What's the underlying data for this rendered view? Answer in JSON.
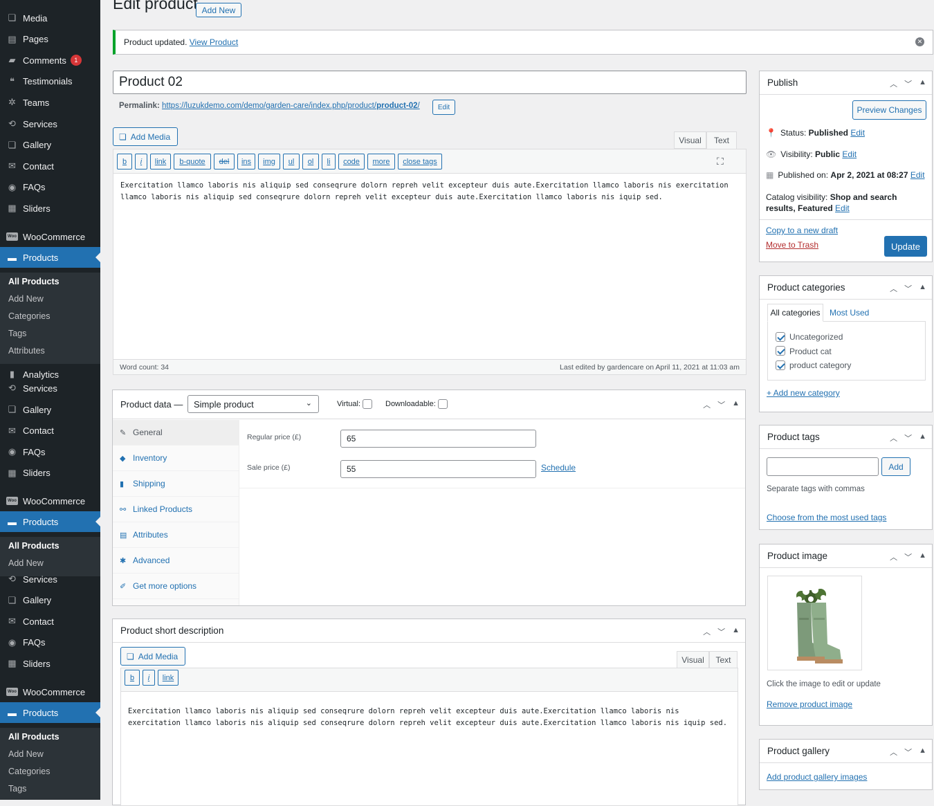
{
  "sidebar": {
    "menu1": [
      {
        "label": "Media",
        "icon": "media-icon"
      },
      {
        "label": "Pages",
        "icon": "pages-icon"
      },
      {
        "label": "Comments",
        "icon": "comments-icon",
        "badge": "1"
      },
      {
        "label": "Testimonials",
        "icon": "testimonials-icon"
      },
      {
        "label": "Teams",
        "icon": "teams-icon"
      },
      {
        "label": "Services",
        "icon": "services-icon"
      },
      {
        "label": "Gallery",
        "icon": "gallery-icon"
      },
      {
        "label": "Contact",
        "icon": "contact-icon"
      },
      {
        "label": "FAQs",
        "icon": "faqs-icon"
      },
      {
        "label": "Sliders",
        "icon": "sliders-icon"
      }
    ],
    "woocommerce": "WooCommerce",
    "products": "Products",
    "sub1": [
      "All Products",
      "Add New",
      "Categories",
      "Tags",
      "Attributes"
    ],
    "menu2": [
      {
        "label": "Analytics",
        "icon": "analytics-icon"
      },
      {
        "label": "Services",
        "icon": "services-icon"
      },
      {
        "label": "Gallery",
        "icon": "gallery-icon"
      },
      {
        "label": "Contact",
        "icon": "contact-icon"
      },
      {
        "label": "FAQs",
        "icon": "faqs-icon"
      },
      {
        "label": "Sliders",
        "icon": "sliders-icon"
      }
    ],
    "sub2": [
      "All Products",
      "Add New"
    ],
    "menu3": [
      {
        "label": "Services",
        "icon": "services-icon"
      },
      {
        "label": "Gallery",
        "icon": "gallery-icon"
      },
      {
        "label": "Contact",
        "icon": "contact-icon"
      },
      {
        "label": "FAQs",
        "icon": "faqs-icon"
      },
      {
        "label": "Sliders",
        "icon": "sliders-icon"
      }
    ],
    "sub3": [
      "All Products",
      "Add New",
      "Categories",
      "Tags"
    ]
  },
  "page": {
    "title": "Edit product",
    "add_new": "Add New"
  },
  "notice": {
    "text": "Product updated.",
    "link": "View Product"
  },
  "post": {
    "title": "Product 02",
    "permalink_label": "Permalink:",
    "permalink_url": "https://luzukdemo.com/demo/garden-care/index.php/product/",
    "permalink_slug": "product-02",
    "permalink_end": "/",
    "edit": "Edit"
  },
  "editor": {
    "add_media": "Add Media",
    "visual": "Visual",
    "text": "Text",
    "quicktags": [
      "b",
      "i",
      "link",
      "b-quote",
      "del",
      "ins",
      "img",
      "ul",
      "ol",
      "li",
      "code",
      "more",
      "close tags"
    ],
    "content": "Exercitation llamco laboris nis aliquip sed conseqrure dolorn repreh velit excepteur duis aute.Exercitation llamco laboris nis exercitation llamco laboris nis aliquip sed conseqrure dolorn repreh velit excepteur duis aute.Exercitation llamco laboris nis iquip sed.",
    "word_count": "Word count: 34",
    "last_edited": "Last edited by gardencare on April 11, 2021 at 11:03 am"
  },
  "product_data": {
    "label": "Product data —",
    "type": "Simple product",
    "virtual": "Virtual:",
    "downloadable": "Downloadable:",
    "tabs": [
      "General",
      "Inventory",
      "Shipping",
      "Linked Products",
      "Attributes",
      "Advanced",
      "Get more options"
    ],
    "regular_label": "Regular price (£)",
    "regular_value": "65",
    "sale_label": "Sale price (£)",
    "sale_value": "55",
    "schedule": "Schedule"
  },
  "short_desc": {
    "title": "Product short description",
    "add_media": "Add Media",
    "visual": "Visual",
    "text": "Text",
    "quicktags": [
      "b",
      "i",
      "link"
    ],
    "content": "Exercitation llamco laboris nis aliquip sed conseqrure dolorn repreh velit excepteur duis aute.Exercitation llamco laboris nis exercitation llamco laboris nis aliquip sed conseqrure dolorn repreh velit excepteur duis aute.Exercitation llamco laboris nis iquip sed."
  },
  "publish": {
    "title": "Publish",
    "preview": "Preview Changes",
    "status_label": "Status:",
    "status_value": "Published",
    "visibility_label": "Visibility:",
    "visibility_value": "Public",
    "published_label": "Published on:",
    "published_value": "Apr 2, 2021 at 08:27",
    "catalog_label": "Catalog visibility:",
    "catalog_value": "Shop and search results, Featured",
    "edit": "Edit",
    "copy": "Copy to a new draft",
    "trash": "Move to Trash",
    "update": "Update"
  },
  "categories": {
    "title": "Product categories",
    "tab_all": "All categories",
    "tab_most": "Most Used",
    "items": [
      "Uncategorized",
      "Product cat",
      "product category"
    ],
    "add": "+ Add new category"
  },
  "tags": {
    "title": "Product tags",
    "add": "Add",
    "hint": "Separate tags with commas",
    "choose": "Choose from the most used tags"
  },
  "image": {
    "title": "Product image",
    "hint": "Click the image to edit or update",
    "remove": "Remove product image"
  },
  "gallery": {
    "title": "Product gallery",
    "add": "Add product gallery images"
  },
  "colors": {
    "accent": "#2271b1",
    "sidebar": "#1d2327",
    "notice": "#00a32a",
    "trash": "#b32d2e"
  }
}
